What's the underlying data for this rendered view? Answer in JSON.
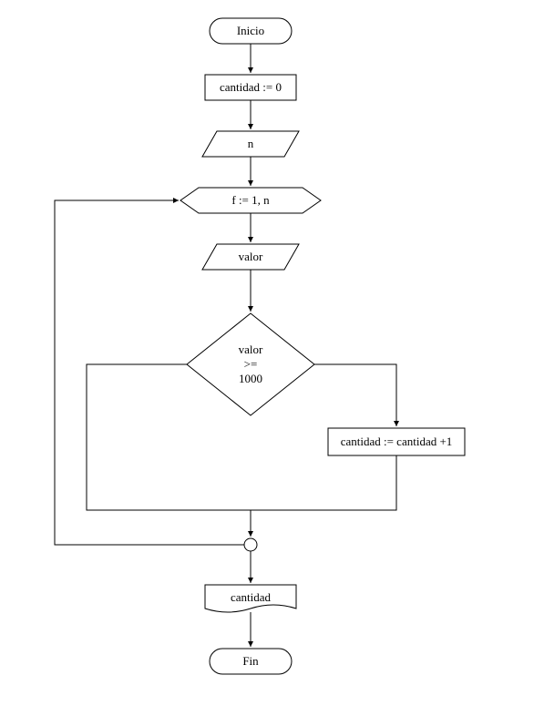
{
  "nodes": {
    "start": "Inicio",
    "init": "cantidad := 0",
    "input_n": "n",
    "loop": "f := 1, n",
    "input_valor": "valor",
    "decision_line1": "valor",
    "decision_line2": ">=",
    "decision_line3": "1000",
    "increment": "cantidad := cantidad +1",
    "output": "cantidad",
    "end": "Fin"
  }
}
